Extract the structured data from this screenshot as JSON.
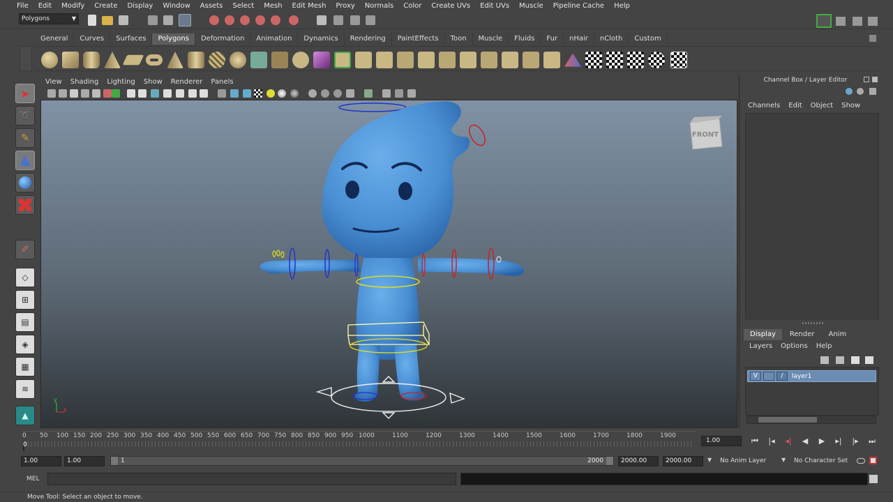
{
  "menubar": {
    "items": [
      "File",
      "Edit",
      "Modify",
      "Create",
      "Display",
      "Window",
      "Assets",
      "Select",
      "Mesh",
      "Edit Mesh",
      "Proxy",
      "Normals",
      "Color",
      "Create UVs",
      "Edit UVs",
      "Muscle",
      "Pipeline Cache",
      "Help"
    ]
  },
  "statusline": {
    "mode": "Polygons"
  },
  "shelf": {
    "tabs": [
      "General",
      "Curves",
      "Surfaces",
      "Polygons",
      "Deformation",
      "Animation",
      "Dynamics",
      "Rendering",
      "PaintEffects",
      "Toon",
      "Muscle",
      "Fluids",
      "Fur",
      "nHair",
      "nCloth",
      "Custom"
    ],
    "active_tab": "Polygons"
  },
  "panel": {
    "menu": [
      "View",
      "Shading",
      "Lighting",
      "Show",
      "Renderer",
      "Panels"
    ]
  },
  "viewport": {
    "view_cube_label": "FRONT",
    "camera_label": "persp",
    "mesh_color": "#4a8fd4",
    "axis_x": "x",
    "axis_y": "y"
  },
  "channel_box": {
    "title": "Channel Box / Layer Editor",
    "menu": [
      "Channels",
      "Edit",
      "Object",
      "Show"
    ]
  },
  "layer_editor": {
    "tabs": [
      "Display",
      "Render",
      "Anim"
    ],
    "active_tab": "Display",
    "menu": [
      "Layers",
      "Options",
      "Help"
    ],
    "layers": [
      {
        "visible": "V",
        "name": "layer1"
      }
    ]
  },
  "time_slider": {
    "ticks": [
      "0",
      "50",
      "100",
      "150",
      "200",
      "250",
      "300",
      "350",
      "400",
      "450",
      "500",
      "550",
      "600",
      "650",
      "700",
      "750",
      "800",
      "850",
      "900",
      "950",
      "1000",
      "1100",
      "1200",
      "1300",
      "1400",
      "1500",
      "1600",
      "1700",
      "1800",
      "1900"
    ],
    "current_frame_label": "0",
    "current_frame_field": "1.00"
  },
  "range": {
    "start": "1.00",
    "anim_start": "1.00",
    "slider_start": "1",
    "slider_end": "2000",
    "anim_end": "2000.00",
    "end": "2000.00",
    "anim_layer": "No Anim Layer",
    "character_set": "No Character Set"
  },
  "command_line": {
    "label": "MEL"
  },
  "help_line": {
    "text": "Move Tool: Select an object to move."
  },
  "colors": {
    "ui_bg": "#444444",
    "layer_highlight": "#6b8cb3",
    "character_blue": "#4a8fd4"
  }
}
